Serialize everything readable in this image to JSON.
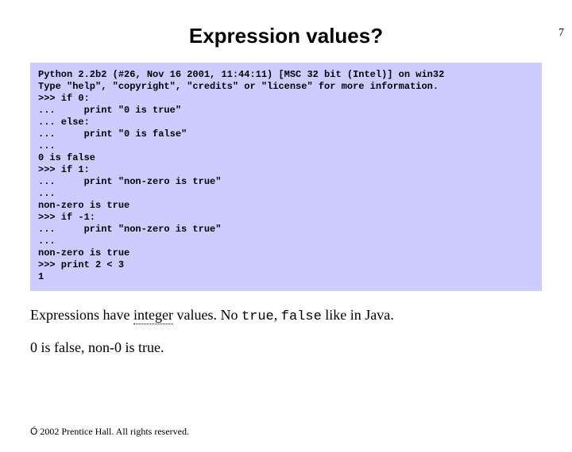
{
  "page_number": "7",
  "title": "Expression values?",
  "code": "Python 2.2b2 (#26, Nov 16 2001, 11:44:11) [MSC 32 bit (Intel)] on win32\nType \"help\", \"copyright\", \"credits\" or \"license\" for more information.\n>>> if 0:\n...     print \"0 is true\"\n... else:\n...     print \"0 is false\"\n...\n0 is false\n>>> if 1:\n...     print \"non-zero is true\"\n...\nnon-zero is true\n>>> if -1:\n...     print \"non-zero is true\"\n...\nnon-zero is true\n>>> print 2 < 3\n1",
  "para1": {
    "seg1": "Expressions have ",
    "underlined": "integer",
    "seg2": " values. No ",
    "mono1": "true",
    "seg3": ", ",
    "mono2": "false",
    "seg4": " like in Java."
  },
  "para2": "0 is false, non-0 is true.",
  "footer": {
    "symbol": "Ó",
    "text": " 2002 Prentice Hall. All rights reserved."
  },
  "chart_data": null
}
